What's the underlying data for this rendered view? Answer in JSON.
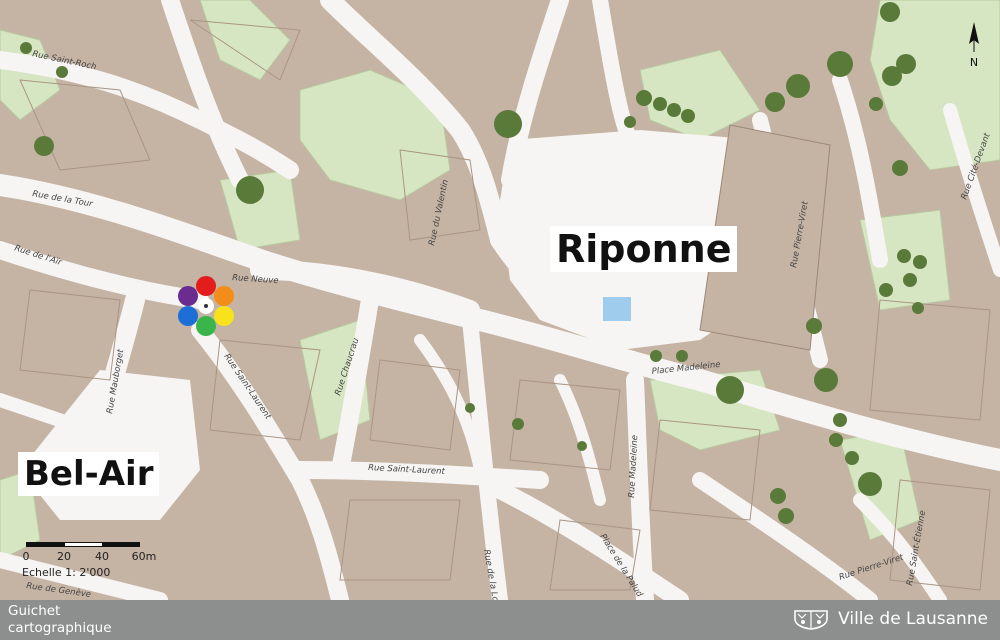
{
  "places": {
    "riponne": "Riponne",
    "belair": "Bel-Air"
  },
  "streets": {
    "saint_roch": "Rue Saint-Roch",
    "tour": "Rue de la Tour",
    "air": "Rue de l'Aïr",
    "neuve": "Rue Neuve",
    "valentin": "Rue du Valentin",
    "mauborget": "Rue Mauborget",
    "saint_laurent_1": "Rue Saint-Laurent",
    "chaucrau": "Rue Chaucrau",
    "saint_laurent_2": "Rue Saint-Laurent",
    "madeleine_rue": "Rue Madeleine",
    "madeleine_place": "Place Madeleine",
    "pierre_viret": "Rue Pierre-Viret",
    "pierre_viret_2": "Rue Pierre-Viret",
    "cite_devant": "Rue Cité-Devant",
    "louve": "Rue de la Louve",
    "palud": "Place de la Palud",
    "saint_etienne": "Rue Saint-Étienne",
    "geneve": "Rue de Genève"
  },
  "north": {
    "label": "N"
  },
  "scale": {
    "ticks": [
      "0",
      "20",
      "40",
      "60m"
    ],
    "echelle": "Echelle 1: 2'000"
  },
  "footer": {
    "line1": "Guichet",
    "line2": "cartographique",
    "brand": "Ville de Lausanne"
  },
  "colors": {
    "building": "#c5b3a4",
    "building_stroke": "#9c8877",
    "street": "#f6f5f3",
    "green": "#d7e6c2",
    "tree": "#5a7a3a",
    "footer": "#8d8e8e",
    "water": "#9fcbec"
  },
  "icons": {
    "compass": "color-wheel-icon",
    "north": "north-arrow-icon",
    "brand": "lausanne-coat-of-arms-icon"
  }
}
